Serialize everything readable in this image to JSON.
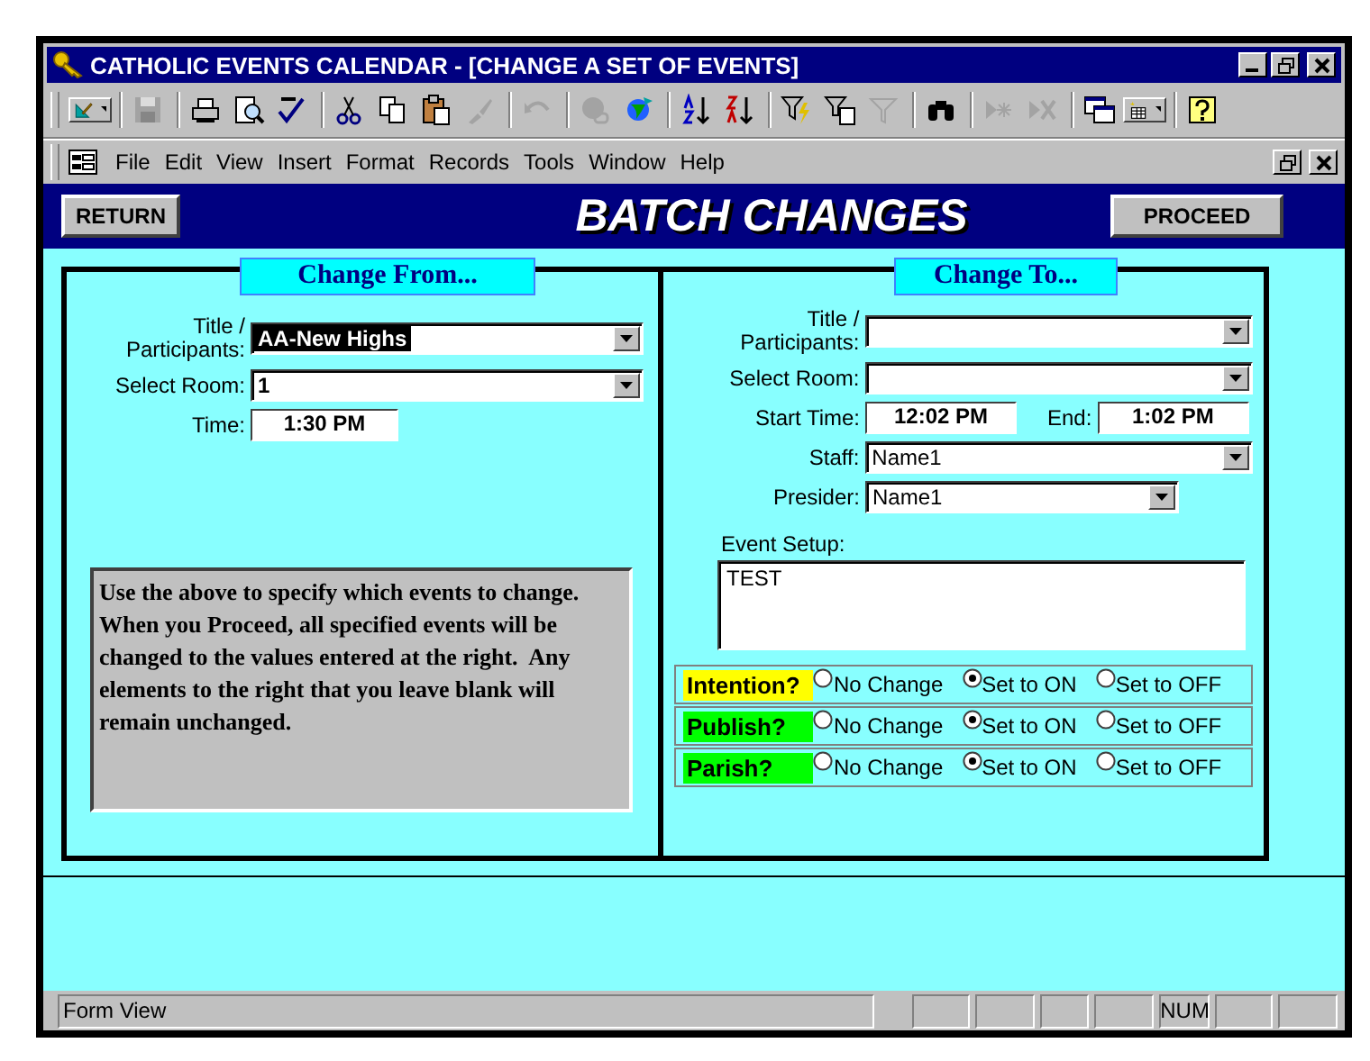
{
  "window": {
    "title": "CATHOLIC EVENTS CALENDAR - [CHANGE A SET OF EVENTS]"
  },
  "menu": [
    "File",
    "Edit",
    "View",
    "Insert",
    "Format",
    "Records",
    "Tools",
    "Window",
    "Help"
  ],
  "form": {
    "title": "BATCH CHANGES",
    "buttons": [
      "RETURN",
      "PROCEED"
    ],
    "change_from": {
      "heading": "Change From...",
      "fields": [
        {
          "kind": "combo",
          "label": "Title /\nParticipants:",
          "value": "AA-New Highs",
          "highlighted": true
        },
        {
          "kind": "combo",
          "label": "Select Room:",
          "value": "1",
          "highlighted": false
        },
        {
          "kind": "time",
          "label": "Time:",
          "value": "1:30 PM"
        }
      ],
      "note": "Use the above to specify which events to change.  When you Proceed, all specified events will be changed to the values entered at the right.  Any elements to the right that you leave blank will remain unchanged."
    },
    "change_to": {
      "heading": "Change To...",
      "fields": [
        {
          "kind": "combo",
          "label": "Title /\nParticipants:"
        },
        {
          "kind": "combo",
          "label": "Select Room:"
        },
        {
          "kind": "times",
          "label": "Start Time:",
          "value": "12:02 PM",
          "end_label": "End:",
          "end_value": "1:02 PM"
        },
        {
          "kind": "combo",
          "label": "Staff:",
          "value": "Name1"
        },
        {
          "kind": "short-combo",
          "label": "Presider:",
          "value": "Name1"
        }
      ],
      "setup_label": "Event Setup:",
      "setup_value": "TEST",
      "options": [
        {
          "label": "Intention?",
          "color": "#ffff00",
          "choices": [
            {
              "label": "No Change",
              "selected": false
            },
            {
              "label": "Set to ON",
              "selected": true
            },
            {
              "label": "Set to OFF",
              "selected": false
            }
          ]
        },
        {
          "label": "Publish?",
          "color": "#00ff00",
          "choices": [
            {
              "label": "No Change",
              "selected": false
            },
            {
              "label": "Set to ON",
              "selected": true
            },
            {
              "label": "Set to OFF",
              "selected": false
            }
          ]
        },
        {
          "label": "Parish?",
          "color": "#00ff00",
          "choices": [
            {
              "label": "No Change",
              "selected": false
            },
            {
              "label": "Set to ON",
              "selected": true
            },
            {
              "label": "Set to OFF",
              "selected": false
            }
          ]
        }
      ]
    }
  },
  "status_bar": {
    "text": "Form View",
    "indicator": "NUM"
  }
}
